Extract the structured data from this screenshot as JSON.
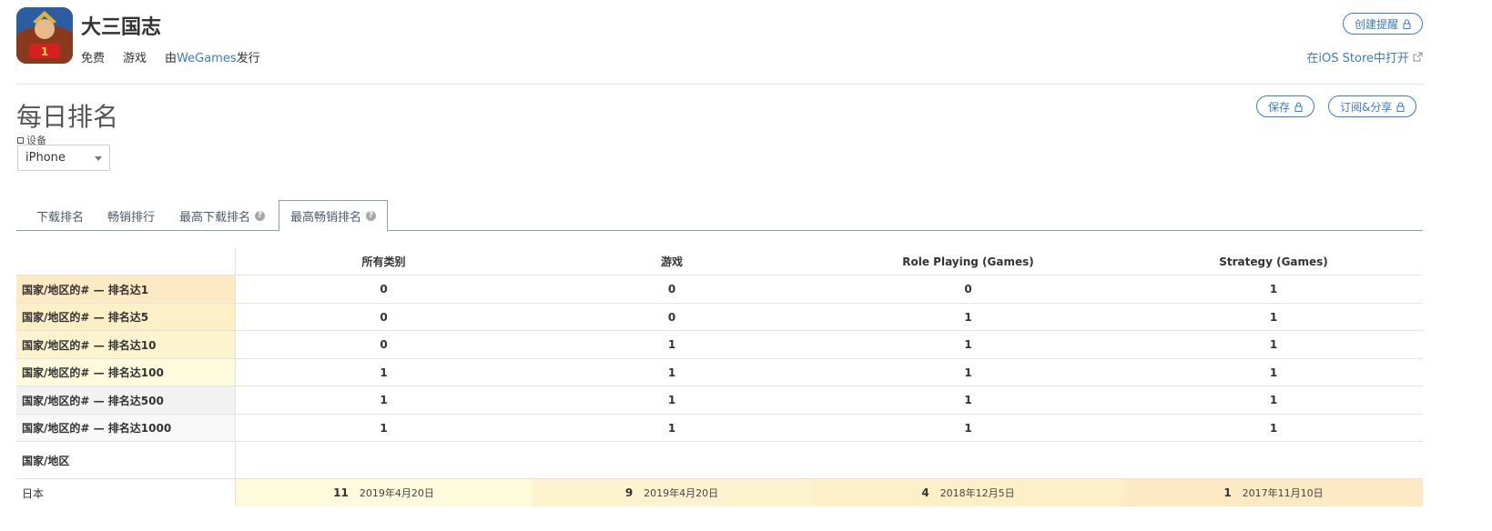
{
  "app": {
    "title": "大三国志",
    "price": "免费",
    "category": "游戏",
    "publisher_prefix": "由",
    "publisher_name": "WeGames",
    "publisher_suffix": "发行",
    "create_alert_label": "创建提醒",
    "ios_store_label": "在iOS Store中打开"
  },
  "section": {
    "title": "每日排名",
    "save_label": "保存",
    "subscribe_label": "订阅&分享",
    "device_label": "设备",
    "device_value": "iPhone"
  },
  "tabs": [
    {
      "label": "下载排名",
      "help": false,
      "active": false
    },
    {
      "label": "畅销排行",
      "help": false,
      "active": false
    },
    {
      "label": "最高下载排名",
      "help": true,
      "active": false
    },
    {
      "label": "最高畅销排名",
      "help": true,
      "active": true
    }
  ],
  "table": {
    "columns": [
      "所有类别",
      "游戏",
      "Role Playing (Games)",
      "Strategy (Games)"
    ],
    "rows": [
      {
        "label": "国家/地区的# — 排名达1",
        "values": [
          "0",
          "0",
          "0",
          "1"
        ],
        "color": "#fde9c2"
      },
      {
        "label": "国家/地区的# — 排名达5",
        "values": [
          "0",
          "0",
          "1",
          "1"
        ],
        "color": "#fdf0c6"
      },
      {
        "label": "国家/地区的# — 排名达10",
        "values": [
          "0",
          "1",
          "1",
          "1"
        ],
        "color": "#fdf4cf"
      },
      {
        "label": "国家/地区的# — 排名达100",
        "values": [
          "1",
          "1",
          "1",
          "1"
        ],
        "color": "#fefbdc"
      },
      {
        "label": "国家/地区的# — 排名达500",
        "values": [
          "1",
          "1",
          "1",
          "1"
        ],
        "color": "#f2f2f2"
      },
      {
        "label": "国家/地区的# — 排名达1000",
        "values": [
          "1",
          "1",
          "1",
          "1"
        ],
        "color": "#f8f8f8"
      }
    ],
    "country_header": "国家/地区",
    "countries": [
      {
        "name": "日本",
        "cells": [
          {
            "rank": "11",
            "date": "2019年4月20日",
            "color": "#fefbdc"
          },
          {
            "rank": "9",
            "date": "2019年4月20日",
            "color": "#fdf4cf"
          },
          {
            "rank": "4",
            "date": "2018年12月5日",
            "color": "#fdf0c6"
          },
          {
            "rank": "1",
            "date": "2017年11月10日",
            "color": "#fde9c2"
          }
        ]
      }
    ]
  }
}
